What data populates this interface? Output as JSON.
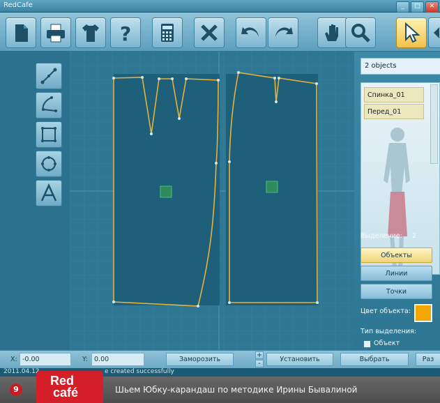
{
  "app": {
    "title": "RedCafe",
    "window_controls": [
      "_",
      "□",
      "✕"
    ]
  },
  "toolbar": {
    "buttons": [
      "new-document",
      "print",
      "garment-model",
      "help",
      "calculator",
      "delete",
      "undo",
      "redo",
      "pan",
      "zoom",
      "select",
      "multi-select"
    ]
  },
  "left_tools": [
    "line-tool",
    "curve-tool",
    "rectangle-tool",
    "circle-tool",
    "text-tool"
  ],
  "right_panel": {
    "object_count": "2 objects",
    "objects": [
      "Спинка_01",
      "Перед_01"
    ],
    "selection_label": "Выделение:",
    "selection_count": "2",
    "mode_buttons": [
      "Объекты",
      "Линии",
      "Точки"
    ],
    "active_mode": "Объекты",
    "object_color_label": "Цвет объекта:",
    "object_color": "#f3a800",
    "selection_type_label": "Тип выделения:",
    "selection_type_option": "Объект"
  },
  "statusbar": {
    "x_label": "X:",
    "x_value": "-0.00",
    "y_label": "Y:",
    "y_value": "0.00",
    "freeze_button": "Заморозить",
    "stepper_plus": "+",
    "stepper_minus": "-",
    "set_button": "Установить",
    "choose_button": "Выбрать",
    "extra_button": "Раз"
  },
  "message": {
    "date": "2011.04.12",
    "text": "e created successfully"
  },
  "caption": {
    "badge": "9",
    "logo_top": "Red",
    "logo_bottom": "café",
    "text": "Шьем Юбку-карандаш по методике Ирины Бывалиной"
  },
  "colors": {
    "canvas_bg": "#2f7894",
    "pattern_fill": "#1e5f7a",
    "pattern_outline": "#e8b23a",
    "accent": "#f3a800"
  }
}
